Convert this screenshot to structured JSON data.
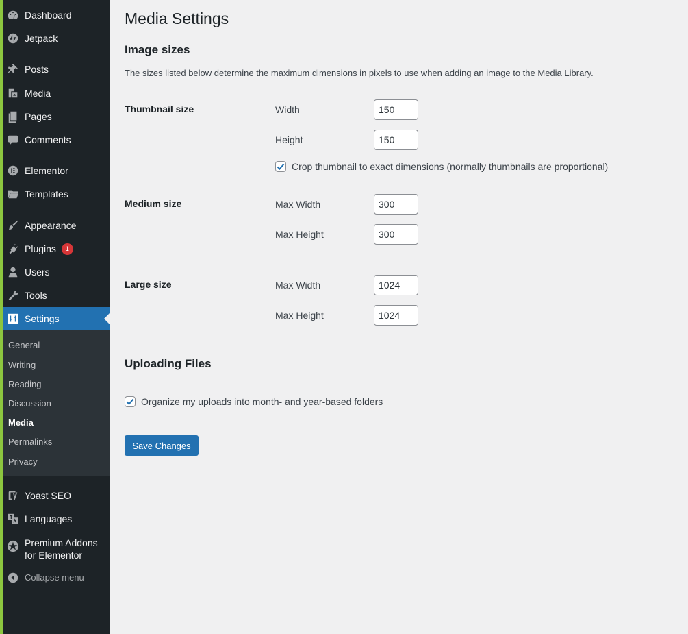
{
  "colors": {
    "sidebar_bg": "#1d2327",
    "submenu_bg": "#2c3338",
    "accent": "#8cc63f",
    "active": "#2271b1",
    "badge": "#d63638",
    "page_bg": "#f0f0f1"
  },
  "sidebar": {
    "items": [
      {
        "label": "Dashboard",
        "icon": "dashboard-icon"
      },
      {
        "label": "Jetpack",
        "icon": "jetpack-icon"
      },
      {
        "label": "Posts",
        "icon": "pin-icon"
      },
      {
        "label": "Media",
        "icon": "media-icon"
      },
      {
        "label": "Pages",
        "icon": "pages-icon"
      },
      {
        "label": "Comments",
        "icon": "comment-icon"
      },
      {
        "label": "Elementor",
        "icon": "elementor-icon"
      },
      {
        "label": "Templates",
        "icon": "folder-icon"
      },
      {
        "label": "Appearance",
        "icon": "paintbrush-icon"
      },
      {
        "label": "Plugins",
        "icon": "plugin-icon",
        "badge": "1"
      },
      {
        "label": "Users",
        "icon": "user-icon"
      },
      {
        "label": "Tools",
        "icon": "wrench-icon"
      },
      {
        "label": "Settings",
        "icon": "settings-icon"
      },
      {
        "label": "Yoast SEO",
        "icon": "yoast-icon"
      },
      {
        "label": "Languages",
        "icon": "translation-icon"
      },
      {
        "label": "Premium Addons",
        "label2": "for Elementor",
        "icon": "premium-addons-icon"
      },
      {
        "label": "Collapse menu",
        "icon": "collapse-icon"
      }
    ],
    "submenu": [
      "General",
      "Writing",
      "Reading",
      "Discussion",
      "Media",
      "Permalinks",
      "Privacy"
    ]
  },
  "page": {
    "title": "Media Settings",
    "image_sizes": {
      "heading": "Image sizes",
      "description": "The sizes listed below determine the maximum dimensions in pixels to use when adding an image to the Media Library.",
      "thumbnail": {
        "title": "Thumbnail size",
        "width_label": "Width",
        "width": "150",
        "height_label": "Height",
        "height": "150",
        "crop_label": "Crop thumbnail to exact dimensions (normally thumbnails are proportional)",
        "crop_checked": true
      },
      "medium": {
        "title": "Medium size",
        "width_label": "Max Width",
        "width": "300",
        "height_label": "Max Height",
        "height": "300"
      },
      "large": {
        "title": "Large size",
        "width_label": "Max Width",
        "width": "1024",
        "height_label": "Max Height",
        "height": "1024"
      }
    },
    "uploading": {
      "heading": "Uploading Files",
      "organize_label": "Organize my uploads into month- and year-based folders",
      "organize_checked": true
    },
    "save_label": "Save Changes"
  }
}
